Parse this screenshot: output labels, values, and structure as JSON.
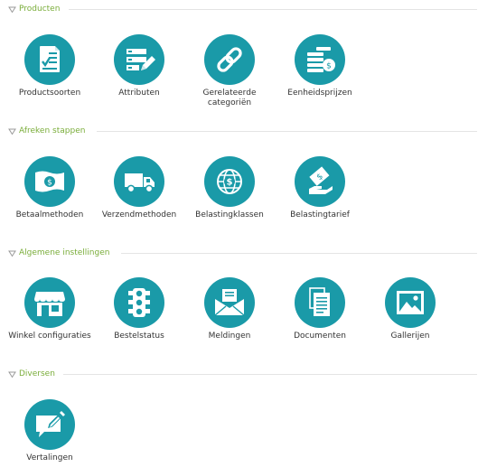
{
  "accent_color": "#1a9aa8",
  "section_title_color": "#7aad3a",
  "sections": [
    {
      "title": "Producten",
      "items": [
        {
          "label": "Productsoorten",
          "icon": "checklist-document-icon"
        },
        {
          "label": "Attributen",
          "icon": "list-edit-icon"
        },
        {
          "label": "Gerelateerde categoriën",
          "icon": "chain-link-icon"
        },
        {
          "label": "Eenheidsprijzen",
          "icon": "coin-stack-icon"
        }
      ]
    },
    {
      "title": "Afreken stappen",
      "items": [
        {
          "label": "Betaalmethoden",
          "icon": "banknote-icon"
        },
        {
          "label": "Verzendmethoden",
          "icon": "delivery-truck-icon"
        },
        {
          "label": "Belastingklassen",
          "icon": "globe-dollar-icon"
        },
        {
          "label": "Belastingtarief",
          "icon": "hand-dollar-icon"
        }
      ]
    },
    {
      "title": "Algemene instellingen",
      "items": [
        {
          "label": "Winkel configuraties",
          "icon": "storefront-icon"
        },
        {
          "label": "Bestelstatus",
          "icon": "traffic-light-icon"
        },
        {
          "label": "Meldingen",
          "icon": "envelope-icon"
        },
        {
          "label": "Documenten",
          "icon": "documents-icon"
        },
        {
          "label": "Gallerijen",
          "icon": "picture-icon"
        }
      ]
    },
    {
      "title": "Diversen",
      "items": [
        {
          "label": "Vertalingen",
          "icon": "speech-bubble-pencil-icon"
        }
      ]
    }
  ]
}
